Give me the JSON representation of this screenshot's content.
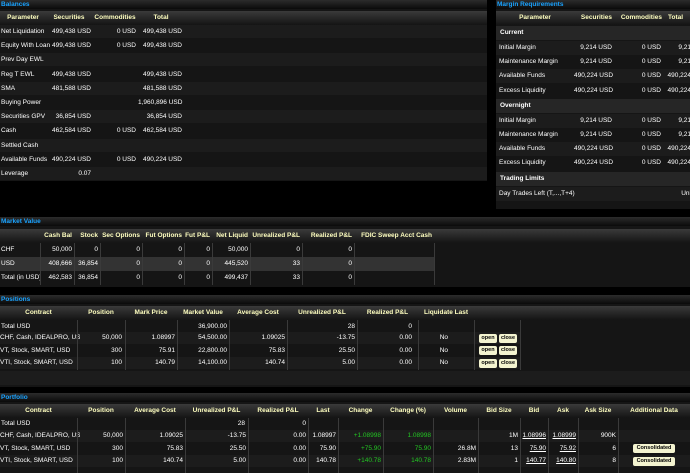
{
  "balances": {
    "title": "Balances",
    "headers": [
      "Parameter",
      "Securities",
      "Commodities",
      "Total"
    ],
    "rows": [
      {
        "param": "Net Liquidation",
        "sec": "499,438 USD",
        "com": "0 USD",
        "total": "499,438 USD"
      },
      {
        "param": "Equity With Loan",
        "sec": "499,438 USD",
        "com": "0 USD",
        "total": "499,438 USD"
      },
      {
        "param": "Prev Day EWL",
        "sec": "",
        "com": "",
        "total": ""
      },
      {
        "param": "Reg T EWL",
        "sec": "499,438 USD",
        "com": "",
        "total": "499,438 USD"
      },
      {
        "param": "SMA",
        "sec": "481,588 USD",
        "com": "",
        "total": "481,588 USD"
      },
      {
        "param": "Buying Power",
        "sec": "",
        "com": "",
        "total": "1,960,896 USD"
      },
      {
        "param": "Securities GPV",
        "sec": "36,854 USD",
        "com": "",
        "total": "36,854 USD"
      },
      {
        "param": "Cash",
        "sec": "462,584 USD",
        "com": "0 USD",
        "total": "462,584 USD"
      },
      {
        "param": "Settled Cash",
        "sec": "",
        "com": "",
        "total": ""
      },
      {
        "param": "Available Funds",
        "sec": "490,224 USD",
        "com": "0 USD",
        "total": "490,224 USD"
      },
      {
        "param": "Leverage",
        "sec": "0.07",
        "com": "",
        "total": ""
      }
    ]
  },
  "margin": {
    "title": "Margin Requirements",
    "headers": [
      "Parameter",
      "Securities",
      "Commodities",
      "Total"
    ],
    "current_label": "Current",
    "current": [
      {
        "param": "Initial Margin",
        "sec": "9,214 USD",
        "com": "0 USD",
        "total": "9,21"
      },
      {
        "param": "Maintenance Margin",
        "sec": "9,214 USD",
        "com": "0 USD",
        "total": "9,21"
      },
      {
        "param": "Available Funds",
        "sec": "490,224 USD",
        "com": "0 USD",
        "total": "490,224"
      },
      {
        "param": "Excess Liquidity",
        "sec": "490,224 USD",
        "com": "0 USD",
        "total": "490,224"
      }
    ],
    "overnight_label": "Overnight",
    "overnight": [
      {
        "param": "Initial Margin",
        "sec": "9,214 USD",
        "com": "0 USD",
        "total": "9,21"
      },
      {
        "param": "Maintenance Margin",
        "sec": "9,214 USD",
        "com": "0 USD",
        "total": "9,21"
      },
      {
        "param": "Available Funds",
        "sec": "490,224 USD",
        "com": "0 USD",
        "total": "490,224"
      },
      {
        "param": "Excess Liquidity",
        "sec": "490,224 USD",
        "com": "0 USD",
        "total": "490,224"
      }
    ],
    "trading_label": "Trading Limits",
    "trading": [
      {
        "param": "Day Trades Left (T,...,T+4)",
        "val": "Unl"
      }
    ]
  },
  "market_value": {
    "title": "Market Value",
    "headers": [
      "",
      "Cash Bal",
      "Stock",
      "Sec Options",
      "Fut Options",
      "Fut P&L",
      "Net Liquid",
      "Unrealized P&L",
      "Realized P&L",
      "FDIC Sweep Acct Cash"
    ],
    "rows": [
      [
        "CHF",
        "50,000",
        "0",
        "0",
        "0",
        "0",
        "50,000",
        "0",
        "0",
        ""
      ],
      [
        "USD",
        "408,666",
        "36,854",
        "0",
        "0",
        "0",
        "445,520",
        "33",
        "0",
        ""
      ],
      [
        "Total (in USD)",
        "462,583",
        "36,854",
        "0",
        "0",
        "0",
        "499,437",
        "33",
        "0",
        ""
      ]
    ]
  },
  "positions": {
    "title": "Positions",
    "headers": [
      "Contract",
      "Position",
      "Mark Price",
      "Market Value",
      "Average Cost",
      "Unrealized P&L",
      "Realized P&L",
      "Liquidate Last"
    ],
    "open_label": "open",
    "close_label": "close",
    "total": {
      "label": "Total USD",
      "value": "36,900.00",
      "unreal": "28",
      "real": "0"
    },
    "rows": [
      {
        "contract": "CHF, Cash, IDEALPRO, USD",
        "pos": "50,000",
        "mark": "1.08997",
        "mval": "54,500.00",
        "avg": "1.09025",
        "unreal": "-13.75",
        "real": "0.00",
        "liq": "No"
      },
      {
        "contract": "VT, Stock, SMART, USD",
        "pos": "300",
        "mark": "75.91",
        "mval": "22,800.00",
        "avg": "75.83",
        "unreal": "25.50",
        "real": "0.00",
        "liq": "No"
      },
      {
        "contract": "VTI, Stock, SMART, USD",
        "pos": "100",
        "mark": "140.79",
        "mval": "14,100.00",
        "avg": "140.74",
        "unreal": "5.00",
        "real": "0.00",
        "liq": "No"
      }
    ]
  },
  "portfolio": {
    "title": "Portfolio",
    "headers": [
      "Contract",
      "Position",
      "Average Cost",
      "Unrealized P&L",
      "Realized P&L",
      "Last",
      "Change",
      "Change (%)",
      "Volume",
      "Bid Size",
      "Bid",
      "Ask",
      "Ask Size",
      "Additional Data"
    ],
    "consolidated_label": "Consolidated",
    "total": {
      "label": "Total USD",
      "unreal": "28",
      "real": "0"
    },
    "rows": [
      {
        "contract": "CHF, Cash, IDEALPRO, USD",
        "pos": "50,000",
        "avg": "1.09025",
        "unreal": "-13.75",
        "real": "0.00",
        "last": "1.08997",
        "chg": "+1.08998",
        "chgp": "1.08998",
        "vol": "",
        "bsize": "1M",
        "bid": "1.08996",
        "ask": "1.08999",
        "asize": "900K",
        "add": false
      },
      {
        "contract": "VT, Stock, SMART, USD",
        "pos": "300",
        "avg": "75.83",
        "unreal": "25.50",
        "real": "0.00",
        "last": "75.90",
        "chg": "+75.90",
        "chgp": "75.90",
        "vol": "26.8M",
        "bsize": "13",
        "bid": "75.90",
        "ask": "75.92",
        "asize": "6",
        "add": true
      },
      {
        "contract": "VTI, Stock, SMART, USD",
        "pos": "100",
        "avg": "140.74",
        "unreal": "5.00",
        "real": "0.00",
        "last": "140.78",
        "chg": "+140.78",
        "chgp": "140.78",
        "vol": "2.83M",
        "bsize": "1",
        "bid": "140.77",
        "ask": "140.80",
        "asize": "8",
        "add": true
      }
    ]
  }
}
